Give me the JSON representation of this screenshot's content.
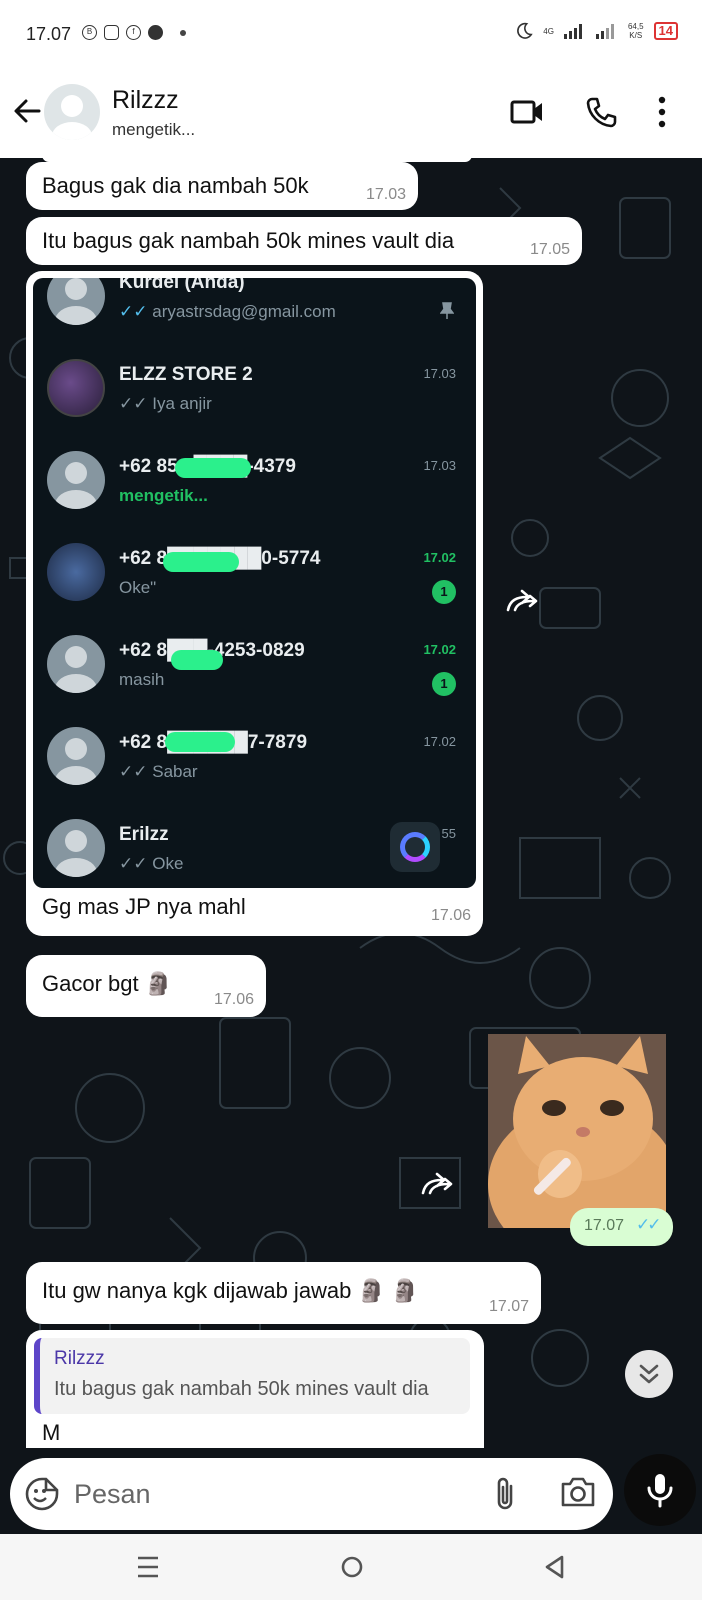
{
  "status_bar": {
    "time": "17.07",
    "network": "4G",
    "speed": "64,5",
    "speed_unit": "K/S",
    "battery": "14"
  },
  "header": {
    "contact_name": "Rilzzz",
    "contact_status": "mengetik..."
  },
  "messages": [
    {
      "type": "incoming",
      "text": "Bagus gak dia nambah 50k",
      "time": "17.03"
    },
    {
      "type": "incoming",
      "text": "Itu bagus gak nambah 50k mines vault dia",
      "time": "17.05"
    },
    {
      "type": "incoming-image",
      "caption": "Gg mas JP nya mahl",
      "time": "17.06",
      "screenshot": {
        "chats": [
          {
            "name": "Kurdel (Anda)",
            "message": "aryastrsdag@gmail.com",
            "time": "",
            "pinned": true,
            "ticks": "✓✓"
          },
          {
            "name": "ELZZ STORE 2",
            "message": "Iya anjir",
            "time": "17.03",
            "ticks": "✓✓"
          },
          {
            "name": "+62 851 ████-4379",
            "message": "mengetik...",
            "time": "17.03",
            "typing": true
          },
          {
            "name": "+62 8███████0-5774",
            "message": "Oke\"",
            "time": "17.02",
            "badge": "1"
          },
          {
            "name": "+62 8███-4253-0829",
            "message": "masih",
            "time": "17.02",
            "badge": "1"
          },
          {
            "name": "+62 8██████7-7879",
            "message": "Sabar",
            "time": "17.02",
            "ticks": "✓✓"
          },
          {
            "name": "Erilzz",
            "message": "Oke",
            "time": "55",
            "ticks": "✓✓"
          }
        ]
      }
    },
    {
      "type": "incoming",
      "text": "Gacor bgt 🗿",
      "time": "17.06"
    },
    {
      "type": "outgoing-sticker",
      "sticker": "cat-smoking-sticker",
      "time": "17.07",
      "ticks": "✓✓"
    },
    {
      "type": "incoming",
      "text": "Itu gw nanya kgk dijawab jawab 🗿 🗿",
      "time": "17.07"
    },
    {
      "type": "incoming-reply",
      "quote_author": "Rilzzz",
      "quote_text": "Itu bagus gak nambah 50k mines vault dia",
      "text": "M"
    }
  ],
  "composer": {
    "placeholder": "Pesan"
  },
  "colors": {
    "chat_bg": "#0f1419",
    "outgoing_bubble": "#d9fdd3",
    "read_tick": "#53bdeb",
    "typing_green": "#21c063"
  }
}
